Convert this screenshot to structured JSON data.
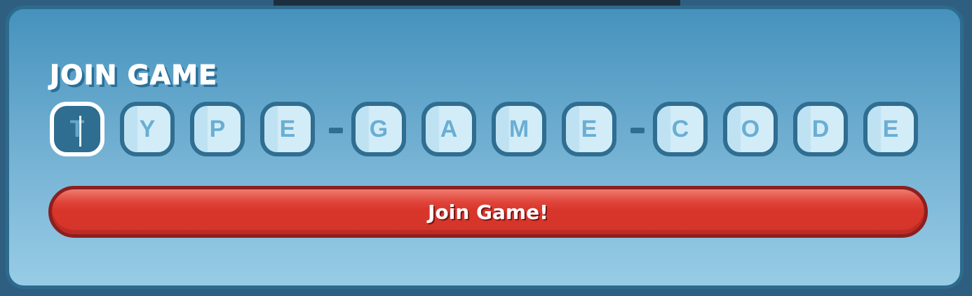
{
  "dialog": {
    "title": "JOIN GAME"
  },
  "code_input": {
    "slots": [
      {
        "char": "T",
        "active": true
      },
      {
        "char": "Y"
      },
      {
        "char": "P"
      },
      {
        "char": "E"
      },
      {
        "char": "G"
      },
      {
        "char": "A"
      },
      {
        "char": "M"
      },
      {
        "char": "E"
      },
      {
        "char": "C"
      },
      {
        "char": "O"
      },
      {
        "char": "D"
      },
      {
        "char": "E"
      }
    ],
    "separator": "-"
  },
  "join_button": {
    "label": "Join Game!"
  },
  "colors": {
    "panel_top": "#4592bd",
    "panel_bottom": "#98cce6",
    "slot_border": "#2f6d91",
    "slot_fill": "#d3edf8",
    "slot_letter": "#6aaed3",
    "button_red": "#d9362b",
    "button_border": "#8c1f1f"
  }
}
